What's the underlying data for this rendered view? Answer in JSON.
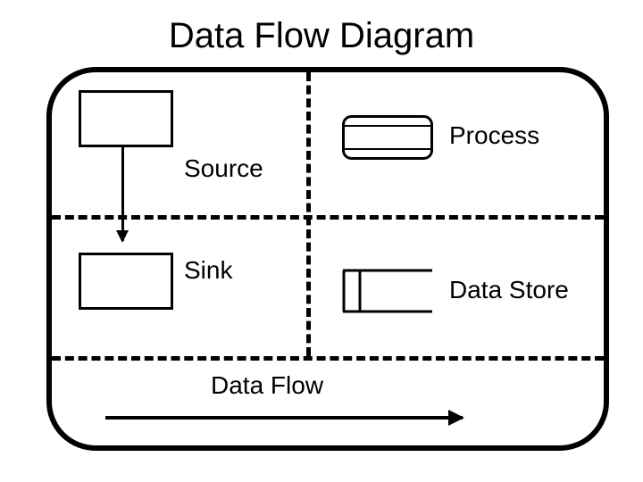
{
  "title": "Data Flow Diagram",
  "cells": {
    "source": "Source",
    "process": "Process",
    "sink": "Sink",
    "datastore": "Data Store",
    "dataflow": "Data Flow"
  }
}
